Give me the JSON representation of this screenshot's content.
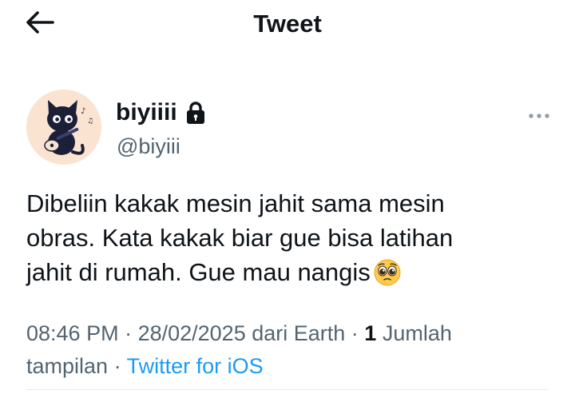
{
  "header": {
    "title": "Tweet",
    "back_icon": "arrow-left-icon"
  },
  "author": {
    "display_name": "biyiiii",
    "handle": "@biyiii",
    "protected_icon": "lock-icon",
    "avatar_description_icon": "avatar-cat-guitar"
  },
  "tweet": {
    "line1": "Dibeliin kakak mesin jahit sama mesin",
    "line2": "obras. Kata kakak biar gue bisa latihan",
    "line3": "jahit di rumah. Gue mau nangis",
    "emoji_icon": "pleading-face-emoji"
  },
  "meta": {
    "time": "08:46 PM",
    "sep1": " · ",
    "date": "28/02/2025",
    "location": " dari Earth",
    "sep2": " · ",
    "views_count": "1",
    "views_label_part1": " Jumlah",
    "views_label_part2": "tampilan",
    "sep3": " · ",
    "source": "Twitter for iOS"
  },
  "colors": {
    "text_primary": "#0f1419",
    "text_secondary": "#536471",
    "link": "#1d9bf0",
    "divider": "#e6e9ec"
  }
}
